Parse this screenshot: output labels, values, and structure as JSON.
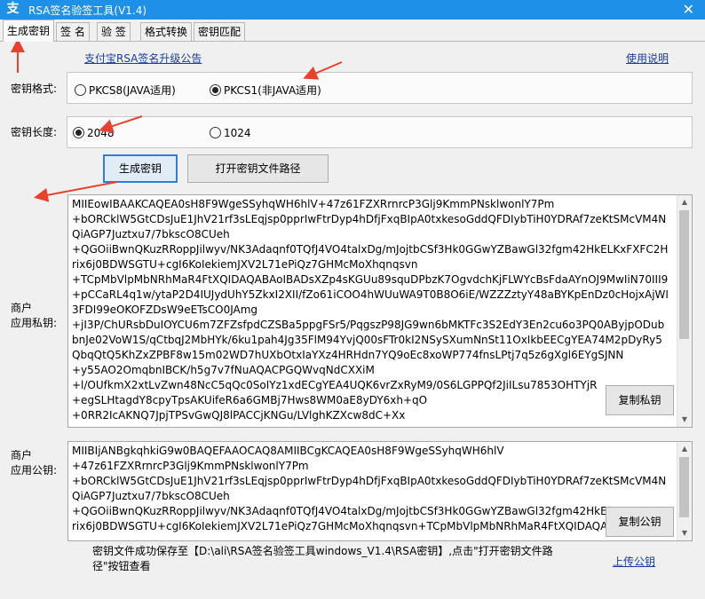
{
  "window": {
    "title": "RSA签名验签工具(V1.4)",
    "close_glyph": "✕",
    "app_icon": "alipay-icon"
  },
  "tabs": [
    {
      "label": "生成密钥",
      "active": true
    },
    {
      "label": "签 名"
    },
    {
      "label": "验 签"
    },
    {
      "label": "格式转换"
    },
    {
      "label": "密钥匹配"
    }
  ],
  "links": {
    "upgrade_notice": "支付宝RSA签名升级公告",
    "help": "使用说明",
    "upload_public_key": "上传公钥"
  },
  "key_format": {
    "label": "密钥格式:",
    "options": [
      {
        "label": "PKCS8(JAVA适用)",
        "selected": false
      },
      {
        "label": "PKCS1(非JAVA适用)",
        "selected": true
      }
    ]
  },
  "key_length": {
    "label": "密钥长度:",
    "options": [
      {
        "label": "2048",
        "selected": true
      },
      {
        "label": "1024",
        "selected": false
      }
    ]
  },
  "buttons": {
    "generate": "生成密钥",
    "open_path": "打开密钥文件路径",
    "copy_private": "复制私钥",
    "copy_public": "复制公钥"
  },
  "private_key": {
    "label_line1": "商户",
    "label_line2": "应用私钥:",
    "text": "MIIEowIBAAKCAQEA0sH8F9WgeSSyhqWH6hlV+47z61FZXRrnrcP3Glj9KmmPNsklwonlY7Pm\n+bORCklW5GtCDsJuE1JhV21rf3sLEqjsp0pprIwFtrDyp4hDfjFxqBIpA0txkesoGddQFDIybTiH0YDRAf7zeKtSMcVM4NQiAGP7Juztxu7/7bkscO8CUeh\n+QGOiiBwnQKuzRRoppJilwyv/NK3Adaqnf0TQfJ4VO4talxDg/mJojtbCSf3Hk0GGwYZBawGl32fgm42HkELKxFXFC2Hrix6j0BDWSGTU+cgI6KoIekiemJXV2L71ePiQz7GHMcMoXhqnqsvn\n+TCpMbVlpMbNRhMaR4FtXQIDAQABAoIBADsXZp4sKGUu89squDPbzK7OgvdchKjFLWYcBsFdaAYnOJ9MwIiN70III9\n+pCCaRL4q1w/ytaP2D4IUJydUhY5ZkxI2XII/fZo61iCOO4hWUuWA9T0B8O6iE/WZZZztyY48aBYKpEnDz0cHojxAjWI3FDI99eOKOFZDsW9eETsCO0JAmg\n+jI3P/ChURsbDuIOYCU6m7ZFZsfpdCZSBa5ppgFSr5/PqgszP98JG9wn6bMKTFc3S2EdY3En2cu6o3PQ0AByjpODubbnJe02VoW1S/qCtbqJ2MbHYk/6ku1pah4Jg35FlM94YvjQ00sFTr0kI2NSySXumNnSt11OxIkbEECgYEA74M2pDyRy5QbqQtQ5KhZxZPBF8w15m02WD7hUXbOtxIaYXz4HRHdn7YQ9oEc8xoWP774fnsLPtj7q5z6gXgl6EYgSJNN\n+y55AO2OmqbnIBCK/h5g7v7fNuAQACPGQWvqNdCXXiM\n+l/OUfkmX2xtLvZwn48NcC5qQc0SoIYz1xdECgYEA4UQK6vrZxRyM9/0S6LGPPQf2JiILsu7853OHTYjR\n+egSLHtagdY8cpyTpsAKUifeR6a6GMBj7Hws8WM0aE8yDY6xh+qO\n+0RR2IcAKNQ7JpjTPSvGwQJ8lPACCjKNGu/LVlghKZXcw8dC+Xx"
  },
  "public_key": {
    "label_line1": "商户",
    "label_line2": "应用公钥:",
    "text": "MIIBIjANBgkqhkiG9w0BAQEFAAOCAQ8AMIIBCgKCAQEA0sH8F9WgeSSyhqWH6hlV\n+47z61FZXRrnrcP3Glj9KmmPNsklwonlY7Pm\n+bORCklW5GtCDsJuE1JhV21rf3sLEqjsp0pprIwFtrDyp4hDfjFxqBIpA0txkesoGddQFDIybTiH0YDRAf7zeKtSMcVM4NQiAGP7Juztxu7/7bkscO8CUeh\n+QGOiiBwnQKuzRRoppJilwyv/NK3Adaqnf0TQfJ4VO4talxDg/mJojtbCSf3Hk0GGwYZBawGl32fgm42HkELKxFXFC2Hrix6j0BDWSGTU+cgI6KoIekiemJXV2L71ePiQz7GHMcMoXhqnqsvn+TCpMbVlpMbNRhMaR4FtXQIDAQAB"
  },
  "status_message": "密钥文件成功保存至【D:\\ali\\RSA签名验签工具windows_V1.4\\RSA密钥】,点击\"打开密钥文件路径\"按钮查看",
  "colors": {
    "titlebar": "#1e90e8",
    "annotation_arrow": "#e8412c",
    "link": "#1a3da5"
  }
}
